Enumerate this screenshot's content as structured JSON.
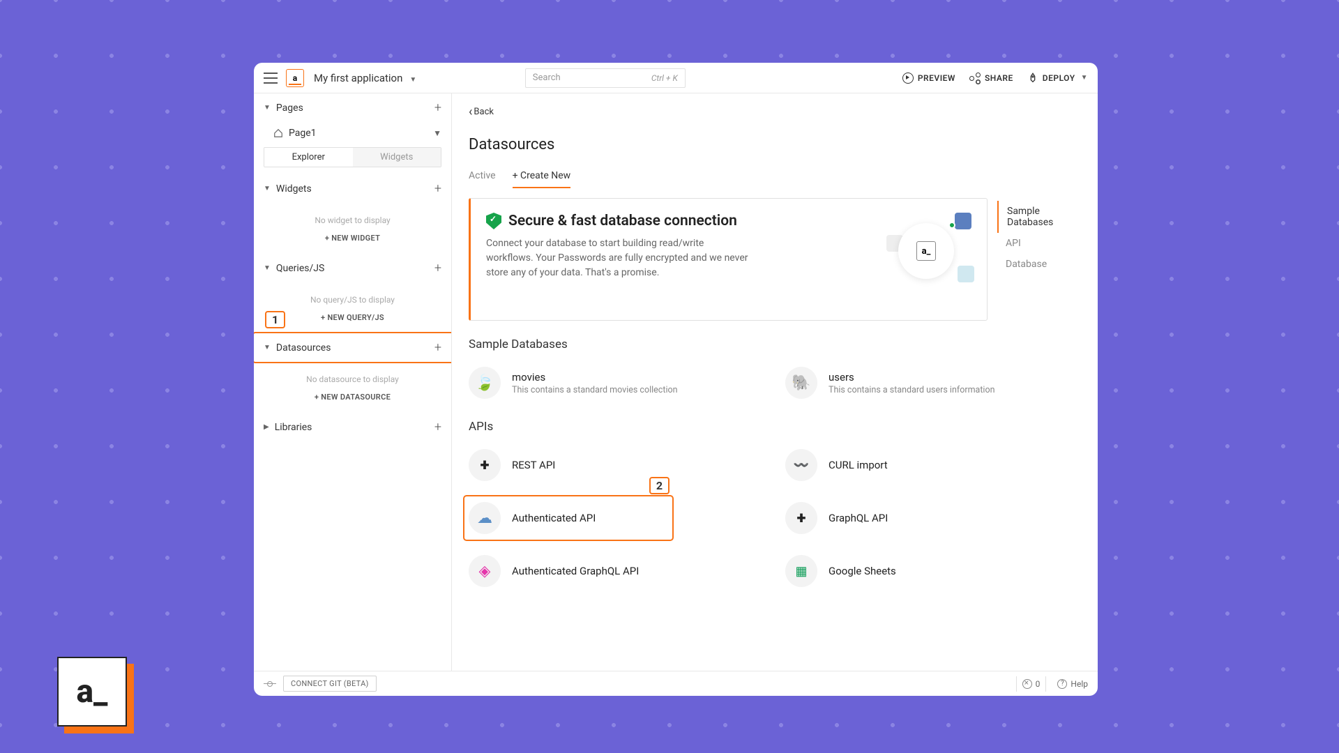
{
  "app": {
    "name": "My first application",
    "search_placeholder": "Search",
    "search_shortcut": "Ctrl + K"
  },
  "top_actions": {
    "preview": "PREVIEW",
    "share": "SHARE",
    "deploy": "DEPLOY"
  },
  "sidebar": {
    "pages": {
      "label": "Pages",
      "items": [
        {
          "name": "Page1"
        }
      ]
    },
    "toggle": {
      "explorer": "Explorer",
      "widgets": "Widgets"
    },
    "widgets": {
      "label": "Widgets",
      "empty": "No widget to display",
      "new_btn": "NEW WIDGET"
    },
    "queries": {
      "label": "Queries/JS",
      "empty": "No query/JS to display",
      "new_btn": "NEW QUERY/JS"
    },
    "datasources": {
      "label": "Datasources",
      "empty": "No datasource to display",
      "new_btn": "NEW DATASOURCE"
    },
    "libraries": {
      "label": "Libraries"
    }
  },
  "content": {
    "back": "Back",
    "title": "Datasources",
    "tabs": {
      "active": "Active",
      "create": "Create New"
    },
    "banner": {
      "title": "Secure & fast database connection",
      "desc": "Connect your database to start building read/write workflows. Your Passwords are fully encrypted and we never store any of your data. That's a promise."
    },
    "sidenav": [
      "Sample Databases",
      "API",
      "Database"
    ],
    "sample_label": "Sample Databases",
    "samples": [
      {
        "title": "movies",
        "sub": "This contains a standard movies collection"
      },
      {
        "title": "users",
        "sub": "This contains a standard users information"
      }
    ],
    "apis_label": "APIs",
    "apis": [
      {
        "title": "REST API"
      },
      {
        "title": "CURL import"
      },
      {
        "title": "Authenticated API"
      },
      {
        "title": "GraphQL API"
      },
      {
        "title": "Authenticated GraphQL API"
      },
      {
        "title": "Google Sheets"
      }
    ]
  },
  "footer": {
    "connect_git": "CONNECT GIT (BETA)",
    "error_count": "0",
    "help": "Help"
  },
  "annotations": {
    "one": "1",
    "two": "2"
  },
  "corner_logo": "a_"
}
